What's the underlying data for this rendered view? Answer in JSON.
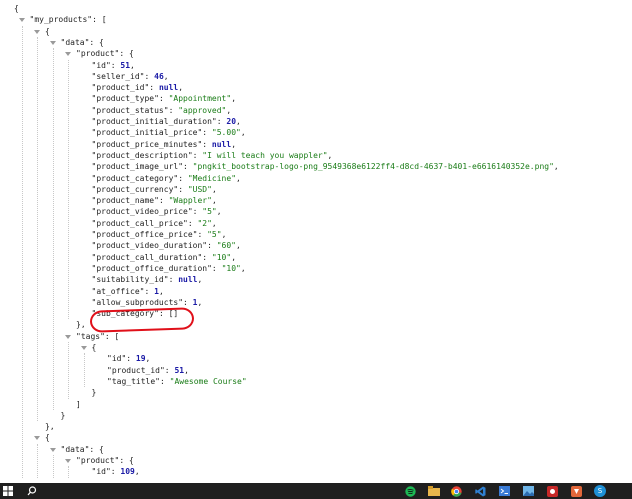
{
  "viewer": {
    "lines": [
      {
        "indent": 0,
        "toggle": false,
        "parts": [
          {
            "t": "{",
            "c": "p"
          }
        ]
      },
      {
        "indent": 1,
        "toggle": true,
        "parts": [
          {
            "t": "\"my_products\"",
            "c": "k"
          },
          {
            "t": ": [",
            "c": "p"
          }
        ]
      },
      {
        "indent": 2,
        "toggle": true,
        "parts": [
          {
            "t": "{",
            "c": "p"
          }
        ]
      },
      {
        "indent": 3,
        "toggle": true,
        "parts": [
          {
            "t": "\"data\"",
            "c": "k"
          },
          {
            "t": ": {",
            "c": "p"
          }
        ]
      },
      {
        "indent": 4,
        "toggle": true,
        "parts": [
          {
            "t": "\"product\"",
            "c": "k"
          },
          {
            "t": ": {",
            "c": "p"
          }
        ]
      },
      {
        "indent": 5,
        "toggle": false,
        "parts": [
          {
            "t": "\"id\"",
            "c": "k"
          },
          {
            "t": ": ",
            "c": "p"
          },
          {
            "t": "51",
            "c": "n"
          },
          {
            "t": ",",
            "c": "p"
          }
        ]
      },
      {
        "indent": 5,
        "toggle": false,
        "parts": [
          {
            "t": "\"seller_id\"",
            "c": "k"
          },
          {
            "t": ": ",
            "c": "p"
          },
          {
            "t": "46",
            "c": "n"
          },
          {
            "t": ",",
            "c": "p"
          }
        ]
      },
      {
        "indent": 5,
        "toggle": false,
        "parts": [
          {
            "t": "\"product_id\"",
            "c": "k"
          },
          {
            "t": ": ",
            "c": "p"
          },
          {
            "t": "null",
            "c": "nl"
          },
          {
            "t": ",",
            "c": "p"
          }
        ]
      },
      {
        "indent": 5,
        "toggle": false,
        "parts": [
          {
            "t": "\"product_type\"",
            "c": "k"
          },
          {
            "t": ": ",
            "c": "p"
          },
          {
            "t": "\"Appointment\"",
            "c": "s"
          },
          {
            "t": ",",
            "c": "p"
          }
        ]
      },
      {
        "indent": 5,
        "toggle": false,
        "parts": [
          {
            "t": "\"product_status\"",
            "c": "k"
          },
          {
            "t": ": ",
            "c": "p"
          },
          {
            "t": "\"approved\"",
            "c": "s"
          },
          {
            "t": ",",
            "c": "p"
          }
        ]
      },
      {
        "indent": 5,
        "toggle": false,
        "parts": [
          {
            "t": "\"product_initial_duration\"",
            "c": "k"
          },
          {
            "t": ": ",
            "c": "p"
          },
          {
            "t": "20",
            "c": "n"
          },
          {
            "t": ",",
            "c": "p"
          }
        ]
      },
      {
        "indent": 5,
        "toggle": false,
        "parts": [
          {
            "t": "\"product_initial_price\"",
            "c": "k"
          },
          {
            "t": ": ",
            "c": "p"
          },
          {
            "t": "\"5.00\"",
            "c": "s"
          },
          {
            "t": ",",
            "c": "p"
          }
        ]
      },
      {
        "indent": 5,
        "toggle": false,
        "parts": [
          {
            "t": "\"product_price_minutes\"",
            "c": "k"
          },
          {
            "t": ": ",
            "c": "p"
          },
          {
            "t": "null",
            "c": "nl"
          },
          {
            "t": ",",
            "c": "p"
          }
        ]
      },
      {
        "indent": 5,
        "toggle": false,
        "parts": [
          {
            "t": "\"product_description\"",
            "c": "k"
          },
          {
            "t": ": ",
            "c": "p"
          },
          {
            "t": "\"I will teach you wappler\"",
            "c": "s"
          },
          {
            "t": ",",
            "c": "p"
          }
        ]
      },
      {
        "indent": 5,
        "toggle": false,
        "parts": [
          {
            "t": "\"product_image_url\"",
            "c": "k"
          },
          {
            "t": ": ",
            "c": "p"
          },
          {
            "t": "\"pngkit_bootstrap-logo-png_9549368e6122ff4-d8cd-4637-b401-e6616140352e.png\"",
            "c": "s"
          },
          {
            "t": ",",
            "c": "p"
          }
        ]
      },
      {
        "indent": 5,
        "toggle": false,
        "parts": [
          {
            "t": "\"product_category\"",
            "c": "k"
          },
          {
            "t": ": ",
            "c": "p"
          },
          {
            "t": "\"Medicine\"",
            "c": "s"
          },
          {
            "t": ",",
            "c": "p"
          }
        ]
      },
      {
        "indent": 5,
        "toggle": false,
        "parts": [
          {
            "t": "\"product_currency\"",
            "c": "k"
          },
          {
            "t": ": ",
            "c": "p"
          },
          {
            "t": "\"USD\"",
            "c": "s"
          },
          {
            "t": ",",
            "c": "p"
          }
        ]
      },
      {
        "indent": 5,
        "toggle": false,
        "parts": [
          {
            "t": "\"product_name\"",
            "c": "k"
          },
          {
            "t": ": ",
            "c": "p"
          },
          {
            "t": "\"Wappler\"",
            "c": "s"
          },
          {
            "t": ",",
            "c": "p"
          }
        ]
      },
      {
        "indent": 5,
        "toggle": false,
        "parts": [
          {
            "t": "\"product_video_price\"",
            "c": "k"
          },
          {
            "t": ": ",
            "c": "p"
          },
          {
            "t": "\"5\"",
            "c": "s"
          },
          {
            "t": ",",
            "c": "p"
          }
        ]
      },
      {
        "indent": 5,
        "toggle": false,
        "parts": [
          {
            "t": "\"product_call_price\"",
            "c": "k"
          },
          {
            "t": ": ",
            "c": "p"
          },
          {
            "t": "\"2\"",
            "c": "s"
          },
          {
            "t": ",",
            "c": "p"
          }
        ]
      },
      {
        "indent": 5,
        "toggle": false,
        "parts": [
          {
            "t": "\"product_office_price\"",
            "c": "k"
          },
          {
            "t": ": ",
            "c": "p"
          },
          {
            "t": "\"5\"",
            "c": "s"
          },
          {
            "t": ",",
            "c": "p"
          }
        ]
      },
      {
        "indent": 5,
        "toggle": false,
        "parts": [
          {
            "t": "\"product_video_duration\"",
            "c": "k"
          },
          {
            "t": ": ",
            "c": "p"
          },
          {
            "t": "\"60\"",
            "c": "s"
          },
          {
            "t": ",",
            "c": "p"
          }
        ]
      },
      {
        "indent": 5,
        "toggle": false,
        "parts": [
          {
            "t": "\"product_call_duration\"",
            "c": "k"
          },
          {
            "t": ": ",
            "c": "p"
          },
          {
            "t": "\"10\"",
            "c": "s"
          },
          {
            "t": ",",
            "c": "p"
          }
        ]
      },
      {
        "indent": 5,
        "toggle": false,
        "parts": [
          {
            "t": "\"product_office_duration\"",
            "c": "k"
          },
          {
            "t": ": ",
            "c": "p"
          },
          {
            "t": "\"10\"",
            "c": "s"
          },
          {
            "t": ",",
            "c": "p"
          }
        ]
      },
      {
        "indent": 5,
        "toggle": false,
        "parts": [
          {
            "t": "\"suitability_id\"",
            "c": "k"
          },
          {
            "t": ": ",
            "c": "p"
          },
          {
            "t": "null",
            "c": "nl"
          },
          {
            "t": ",",
            "c": "p"
          }
        ]
      },
      {
        "indent": 5,
        "toggle": false,
        "parts": [
          {
            "t": "\"at_office\"",
            "c": "k"
          },
          {
            "t": ": ",
            "c": "p"
          },
          {
            "t": "1",
            "c": "n"
          },
          {
            "t": ",",
            "c": "p"
          }
        ]
      },
      {
        "indent": 5,
        "toggle": false,
        "parts": [
          {
            "t": "\"allow_subproducts\"",
            "c": "k"
          },
          {
            "t": ": ",
            "c": "p"
          },
          {
            "t": "1",
            "c": "n"
          },
          {
            "t": ",",
            "c": "p"
          }
        ]
      },
      {
        "indent": 5,
        "toggle": false,
        "parts": [
          {
            "t": "\"sub_category\"",
            "c": "k"
          },
          {
            "t": ": []",
            "c": "p"
          }
        ]
      },
      {
        "indent": 4,
        "toggle": false,
        "parts": [
          {
            "t": "},",
            "c": "p"
          }
        ]
      },
      {
        "indent": 4,
        "toggle": true,
        "parts": [
          {
            "t": "\"tags\"",
            "c": "k"
          },
          {
            "t": ": [",
            "c": "p"
          }
        ]
      },
      {
        "indent": 5,
        "toggle": true,
        "parts": [
          {
            "t": "{",
            "c": "p"
          }
        ]
      },
      {
        "indent": 6,
        "toggle": false,
        "parts": [
          {
            "t": "\"id\"",
            "c": "k"
          },
          {
            "t": ": ",
            "c": "p"
          },
          {
            "t": "19",
            "c": "n"
          },
          {
            "t": ",",
            "c": "p"
          }
        ]
      },
      {
        "indent": 6,
        "toggle": false,
        "parts": [
          {
            "t": "\"product_id\"",
            "c": "k"
          },
          {
            "t": ": ",
            "c": "p"
          },
          {
            "t": "51",
            "c": "n"
          },
          {
            "t": ",",
            "c": "p"
          }
        ]
      },
      {
        "indent": 6,
        "toggle": false,
        "parts": [
          {
            "t": "\"tag_title\"",
            "c": "k"
          },
          {
            "t": ": ",
            "c": "p"
          },
          {
            "t": "\"Awesome Course\"",
            "c": "s"
          }
        ]
      },
      {
        "indent": 5,
        "toggle": false,
        "parts": [
          {
            "t": "}",
            "c": "p"
          }
        ]
      },
      {
        "indent": 4,
        "toggle": false,
        "parts": [
          {
            "t": "]",
            "c": "p"
          }
        ]
      },
      {
        "indent": 3,
        "toggle": false,
        "parts": [
          {
            "t": "}",
            "c": "p"
          }
        ]
      },
      {
        "indent": 2,
        "toggle": false,
        "parts": [
          {
            "t": "},",
            "c": "p"
          }
        ]
      },
      {
        "indent": 2,
        "toggle": true,
        "parts": [
          {
            "t": "{",
            "c": "p"
          }
        ]
      },
      {
        "indent": 3,
        "toggle": true,
        "parts": [
          {
            "t": "\"data\"",
            "c": "k"
          },
          {
            "t": ": {",
            "c": "p"
          }
        ]
      },
      {
        "indent": 4,
        "toggle": true,
        "parts": [
          {
            "t": "\"product\"",
            "c": "k"
          },
          {
            "t": ": {",
            "c": "p"
          }
        ]
      },
      {
        "indent": 5,
        "toggle": false,
        "parts": [
          {
            "t": "\"id\"",
            "c": "k"
          },
          {
            "t": ": ",
            "c": "p"
          },
          {
            "t": "109",
            "c": "n"
          },
          {
            "t": ",",
            "c": "p"
          }
        ]
      }
    ]
  },
  "taskbar": {
    "icons": [
      {
        "name": "windows-start-icon",
        "label": "",
        "color": "#ffffff"
      },
      {
        "name": "search-icon",
        "label": "",
        "color": "#ffffff"
      },
      {
        "name": "spotify-icon",
        "label": "",
        "color": "#1db954"
      },
      {
        "name": "file-explorer-icon",
        "label": "",
        "color": "#e8b64c"
      },
      {
        "name": "notepad-icon",
        "label": "",
        "color": "#5aa3e8"
      },
      {
        "name": "chrome-icon",
        "label": "",
        "color": "#e94235"
      },
      {
        "name": "vscode-icon",
        "label": "",
        "color": "#2f80d1"
      },
      {
        "name": "terminal-icon",
        "label": "",
        "color": "#3a7bd5"
      },
      {
        "name": "gallery-icon",
        "label": "",
        "color": "#6fb6e8"
      },
      {
        "name": "app-red-icon",
        "label": "",
        "color": "#c62828"
      },
      {
        "name": "app-orange-icon",
        "label": "",
        "color": "#e2673a"
      },
      {
        "name": "skype-icon",
        "label": "S",
        "color": "#1e90d6"
      }
    ]
  },
  "colors": {
    "string": "#1a7c17",
    "number": "#1a1aa6",
    "annotation": "#e0101a",
    "taskbar": "#1f1f1f"
  }
}
